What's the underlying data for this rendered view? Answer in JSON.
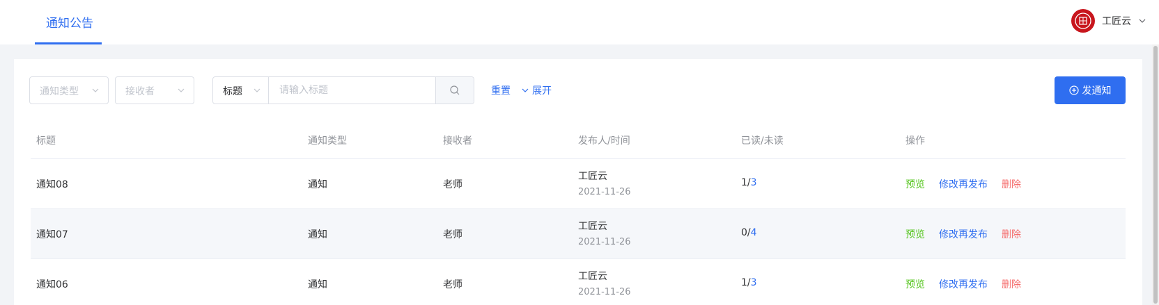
{
  "header": {
    "tab_label": "通知公告",
    "user_name": "工匠云",
    "avatar_icon": "seal-logo-icon"
  },
  "filters": {
    "type_placeholder": "通知类型",
    "receiver_placeholder": "接收者",
    "search_field": "标题",
    "search_placeholder": "请输入标题",
    "reset_label": "重置",
    "expand_label": "展开",
    "publish_label": "发通知"
  },
  "table": {
    "columns": {
      "title": "标题",
      "type": "通知类型",
      "receiver": "接收者",
      "publisher": "发布人/时间",
      "read": "已读/未读",
      "actions": "操作"
    },
    "rows": [
      {
        "title": "通知08",
        "type": "通知",
        "receiver": "老师",
        "publisher": "工匠云",
        "date": "2021-11-26",
        "read": "1/",
        "unread": "3"
      },
      {
        "title": "通知07",
        "type": "通知",
        "receiver": "老师",
        "publisher": "工匠云",
        "date": "2021-11-26",
        "read": "0/",
        "unread": "4"
      },
      {
        "title": "通知06",
        "type": "通知",
        "receiver": "老师",
        "publisher": "工匠云",
        "date": "2021-11-26",
        "read": "1/",
        "unread": "3"
      }
    ],
    "actions": {
      "preview": "预览",
      "edit": "修改再发布",
      "delete": "删除"
    }
  },
  "colors": {
    "accent": "#2f6ef0",
    "preview": "#52c41a",
    "delete": "#f56c6c",
    "avatar": "#c8161d"
  }
}
